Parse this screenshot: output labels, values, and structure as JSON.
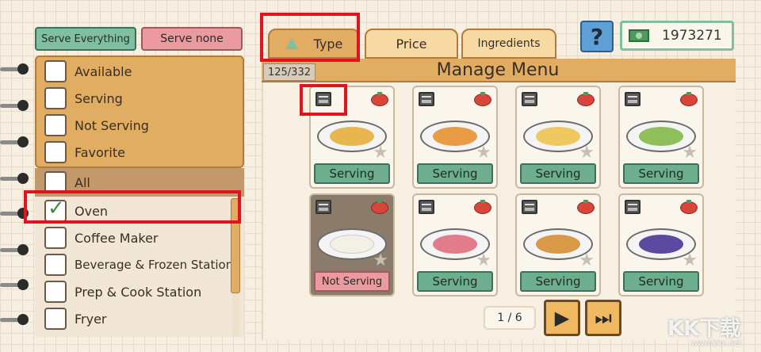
{
  "top_buttons": {
    "serve_everything": "Serve Everything",
    "serve_none": "Serve none"
  },
  "status_filters": [
    {
      "label": "Available",
      "checked": false
    },
    {
      "label": "Serving",
      "checked": false
    },
    {
      "label": "Not Serving",
      "checked": false
    },
    {
      "label": "Favorite",
      "checked": false
    }
  ],
  "category_filters": [
    {
      "label": "All",
      "checked": false
    },
    {
      "label": "Oven",
      "checked": true
    },
    {
      "label": "Coffee Maker",
      "checked": false
    },
    {
      "label": "Beverage & Frozen Station",
      "checked": false
    },
    {
      "label": "Prep & Cook Station",
      "checked": false
    },
    {
      "label": "Fryer",
      "checked": false
    }
  ],
  "tabs": {
    "type": "Type",
    "price": "Price",
    "ingredients": "Ingredients"
  },
  "currency": "1973271",
  "help_symbol": "?",
  "menu": {
    "title": "Manage Menu",
    "count": "125/332",
    "page": "1 / 6"
  },
  "dishes": [
    {
      "status": "Serving",
      "food_color": "#e8b64e"
    },
    {
      "status": "Serving",
      "food_color": "#e89d44"
    },
    {
      "status": "Serving",
      "food_color": "#f0c860"
    },
    {
      "status": "Serving",
      "food_color": "#8fbf5a"
    },
    {
      "status": "Not Serving",
      "food_color": "#f5f0e6"
    },
    {
      "status": "Serving",
      "food_color": "#e27b8a"
    },
    {
      "status": "Serving",
      "food_color": "#d99a48"
    },
    {
      "status": "Serving",
      "food_color": "#5b4aa0"
    }
  ],
  "watermark": {
    "main": "KK下载",
    "sub": "www.kkx.net"
  },
  "colors": {
    "serving_green": "#6cae8e",
    "not_serving_pink": "#eb9a9f",
    "orange_accent": "#e0ad62",
    "highlight_red": "#e0141e"
  }
}
